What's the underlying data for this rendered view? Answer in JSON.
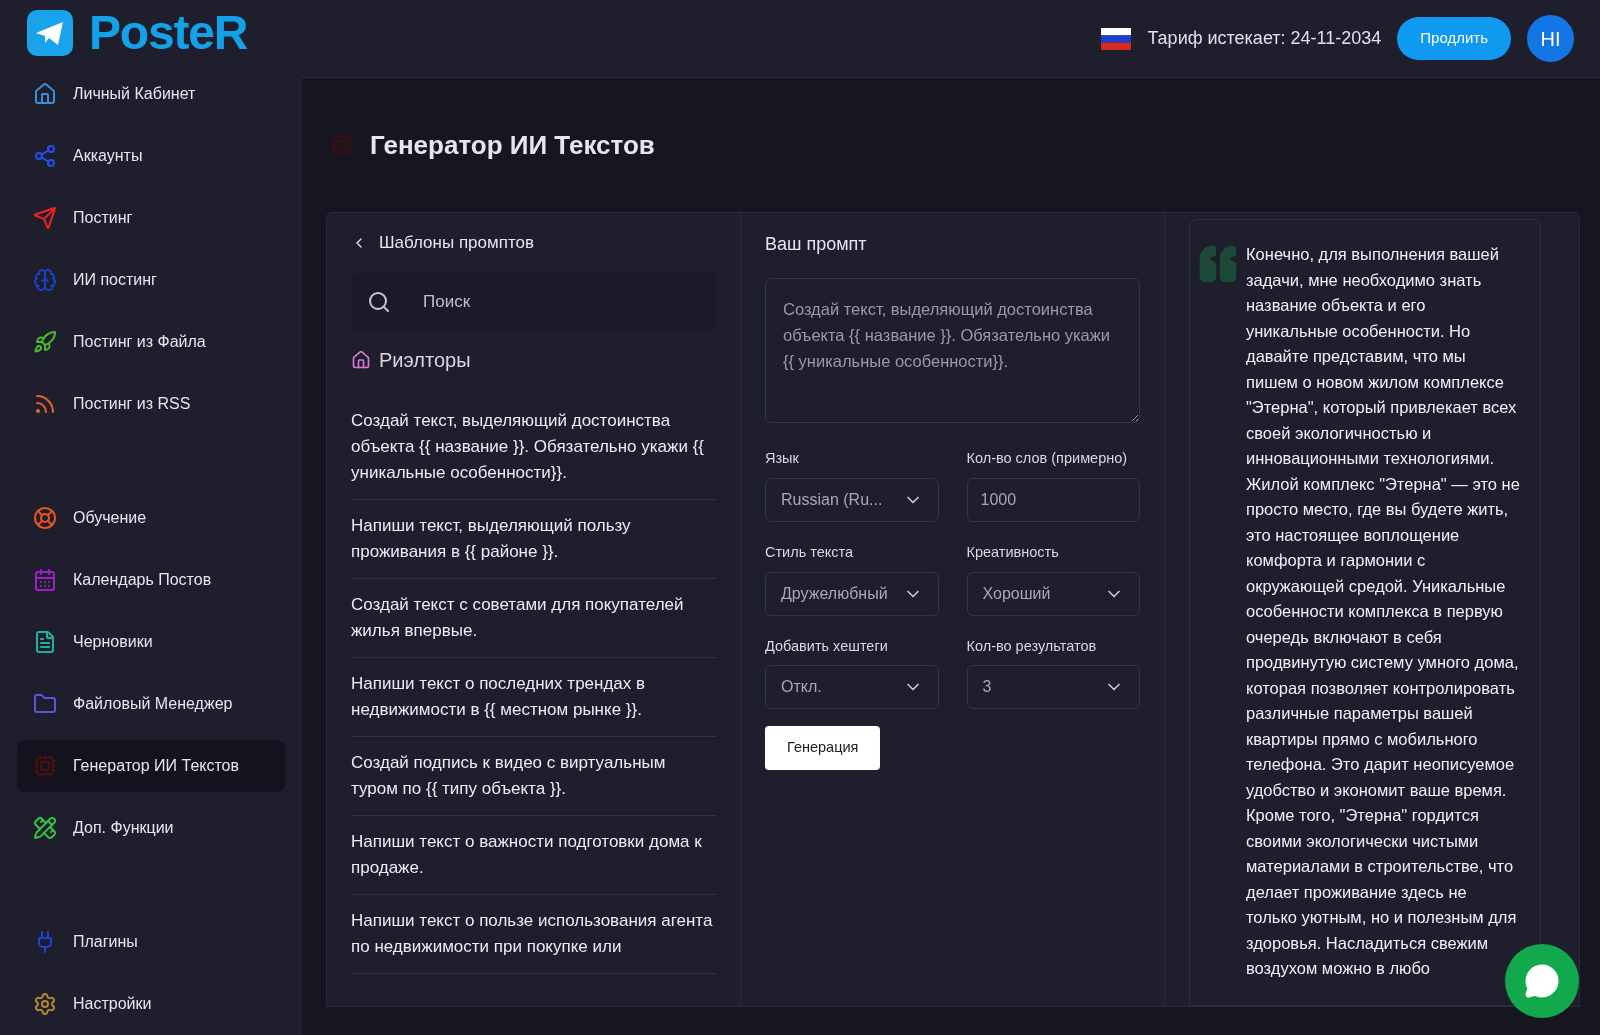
{
  "logo": {
    "text": "PosteR"
  },
  "sidebar": {
    "sections": [
      [
        {
          "label": "Личный Кабинет",
          "kind": "home",
          "selected": false
        },
        {
          "label": "Аккаунты",
          "kind": "share",
          "selected": false
        },
        {
          "label": "Постинг",
          "kind": "send",
          "selected": false
        },
        {
          "label": "ИИ постинг",
          "kind": "brain",
          "selected": false
        },
        {
          "label": "Постинг из Файла",
          "kind": "rocket",
          "selected": false
        },
        {
          "label": "Постинг из RSS",
          "kind": "rss",
          "selected": false
        }
      ],
      [
        {
          "label": "Обучение",
          "kind": "lifebuoy",
          "selected": false
        },
        {
          "label": "Календарь Постов",
          "kind": "calendar",
          "selected": false
        },
        {
          "label": "Черновики",
          "kind": "file",
          "selected": false
        },
        {
          "label": "Файловый Менеджер",
          "kind": "folder",
          "selected": false
        },
        {
          "label": "Генератор ИИ Текстов",
          "kind": "chip",
          "selected": true
        },
        {
          "label": "Доп. Функции",
          "kind": "pencil",
          "selected": false
        }
      ],
      [
        {
          "label": "Плагины",
          "kind": "plug",
          "selected": false
        },
        {
          "label": "Настройки",
          "kind": "gear",
          "selected": false
        }
      ]
    ]
  },
  "header": {
    "tariff": "Тариф истекает: 24-11-2034",
    "renew_button": "Продлить",
    "avatar": "HI"
  },
  "page_title": "Генератор ИИ Текстов",
  "templates": {
    "title": "Шаблоны промптов",
    "search": {
      "placeholder": "Поиск"
    },
    "category": "Риэлторы",
    "items": [
      "Создай текст, выделяющий достоинства объекта {{ название }}. Обязательно укажи {{ уникальные особенности}}.",
      "Напиши текст, выделяющий пользу проживания в {{ районе }}.",
      "Создай текст с советами для покупателей жилья впервые.",
      "Напиши текст о последних трендах в недвижимости в {{ местном рынке }}.",
      "Создай подпись к видео с виртуальным туром по {{ типу объекта }}.",
      "Напиши текст о важности подготовки дома к продаже.",
      "Напиши текст о пользе использования агента по недвижимости при покупке или"
    ]
  },
  "prompt": {
    "title": "Ваш промпт",
    "placeholder": "Создай текст, выделяющий достоинства объекта {{ название }}. Обязательно укажи {{ уникальные особенности}}.",
    "fields": [
      {
        "label": "Язык",
        "kind": "select",
        "value": "Russian (Ru..."
      },
      {
        "label": "Кол-во слов (примерно)",
        "kind": "input",
        "value": "1000"
      },
      {
        "label": "Стиль текста",
        "kind": "select",
        "value": "Дружелюбный"
      },
      {
        "label": "Креативность",
        "kind": "select",
        "value": "Хороший"
      },
      {
        "label": "Добавить хештеги",
        "kind": "select",
        "value": "Откл."
      },
      {
        "label": "Кол-во результатов",
        "kind": "select",
        "value": "3"
      }
    ],
    "button": "Генерация"
  },
  "result": {
    "text": "Конечно, для выполнения вашей задачи, мне необходимо знать название объекта и его уникальные особенности. Но давайте представим, что мы пишем о новом жилом комплексе \"Этерна\", который привлекает всех своей экологичностью и инновационными технологиями. Жилой комплекс \"Этерна\" — это не просто место, где вы будете жить, это настоящее воплощение комфорта и гармонии с окружающей средой. Уникальные особенности комплекса в первую очередь включают в себя продвинутую систему умного дома, которая позволяет контролировать различные параметры вашей квартиры прямо с мобильного телефона. Это дарит неописуемое удобство и экономит ваше время. Кроме того, \"Этерна\" гордится своими экологически чистыми материалами в строительстве, что делает проживание здесь не только уютным, но и полезным для здоровья. Насладиться свежим воздухом можно в любо"
  }
}
